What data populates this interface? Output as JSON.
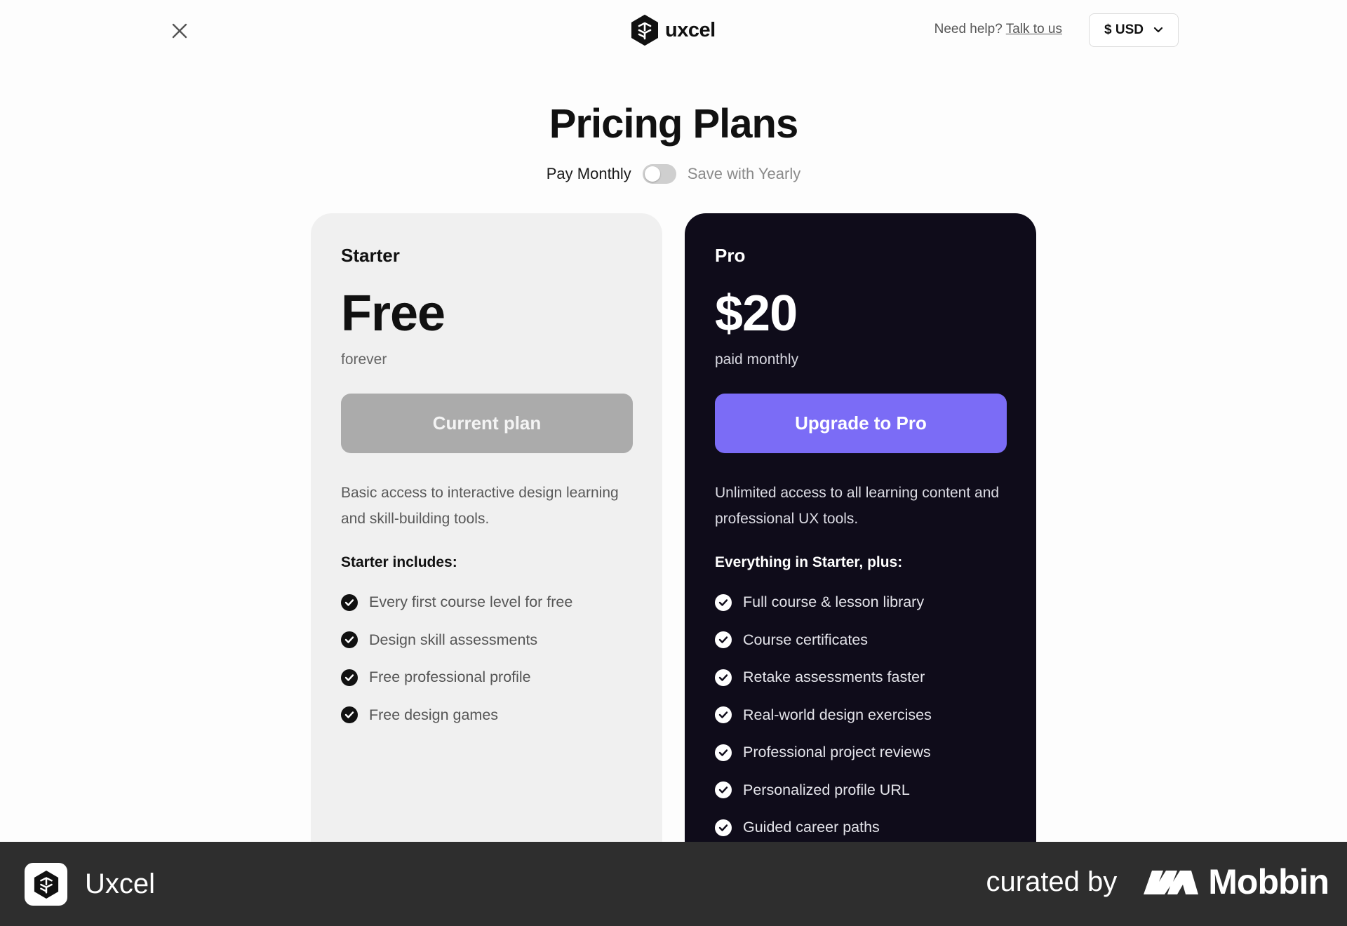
{
  "header": {
    "brand_name": "uxcel",
    "help_text": "Need help?",
    "help_link": "Talk to us",
    "currency": "$ USD"
  },
  "page": {
    "title": "Pricing Plans"
  },
  "billing": {
    "monthly_label": "Pay Monthly",
    "yearly_label": "Save with Yearly",
    "yearly_selected": false
  },
  "plans": {
    "starter": {
      "name": "Starter",
      "price": "Free",
      "period": "forever",
      "cta": "Current plan",
      "description": "Basic access to interactive design learning and skill-building tools.",
      "includes_heading": "Starter includes:",
      "features": [
        "Every first course level for free",
        "Design skill assessments",
        "Free professional profile",
        "Free design games"
      ]
    },
    "pro": {
      "name": "Pro",
      "price": "$20",
      "period": "paid monthly",
      "cta": "Upgrade to Pro",
      "description": "Unlimited access to all learning content and professional UX tools.",
      "includes_heading": "Everything in Starter, plus:",
      "features": [
        "Full course & lesson library",
        "Course certificates",
        "Retake assessments faster",
        "Real-world design exercises",
        "Professional project reviews",
        "Personalized profile URL",
        "Guided career paths"
      ]
    }
  },
  "footer": {
    "app_name": "Uxcel",
    "curated_by": "curated by",
    "curator": "Mobbin"
  },
  "colors": {
    "accent": "#7b6cf6",
    "pro_card_bg": "#0f0c1a",
    "starter_card_bg": "#f0f0f0",
    "disabled_button": "#ababab",
    "footer_bg": "#2e2e2e"
  },
  "icons": {
    "close": "close-icon",
    "logo": "uxcel-logo-icon",
    "dropdown": "chevron-down-icon",
    "check": "check-circle-icon"
  }
}
